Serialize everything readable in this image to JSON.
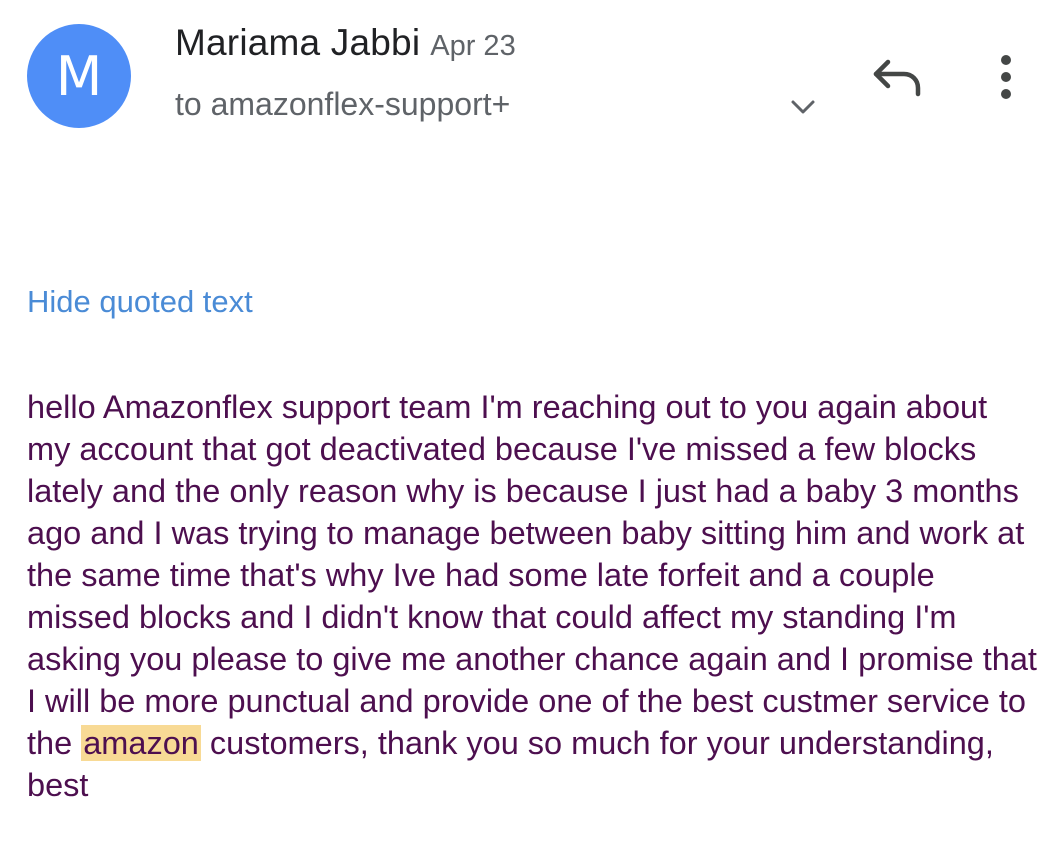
{
  "header": {
    "avatar_letter": "M",
    "sender_name": "Mariama Jabbi",
    "date": "Apr 23",
    "recipients": "to amazonflex-support+",
    "icons": {
      "expand": "chevron-down-icon",
      "reply": "reply-icon",
      "more": "more-vert-icon"
    }
  },
  "hide_quoted_label": "Hide quoted text",
  "body": {
    "text_before": "hello Amazonflex support team I'm reaching out to you again about my account that got deactivated because I've missed a few blocks lately and the only reason why is because I just had a baby 3 months ago and I was trying to manage between baby sitting him and work at the same time that's why Ive had some late forfeit and a couple missed blocks and I didn't know that could affect my standing I'm asking you please to give me another chance again and I promise that I will be more punctual and provide one of the best custmer service to the",
    "highlighted": "amazon",
    "text_after": "customers, thank you so much for your understanding, best"
  },
  "colors": {
    "avatar_bg": "#4f8ef7",
    "link": "#4a8bd6",
    "body_text": "#4d0f4f",
    "highlight": "#f8da95"
  }
}
